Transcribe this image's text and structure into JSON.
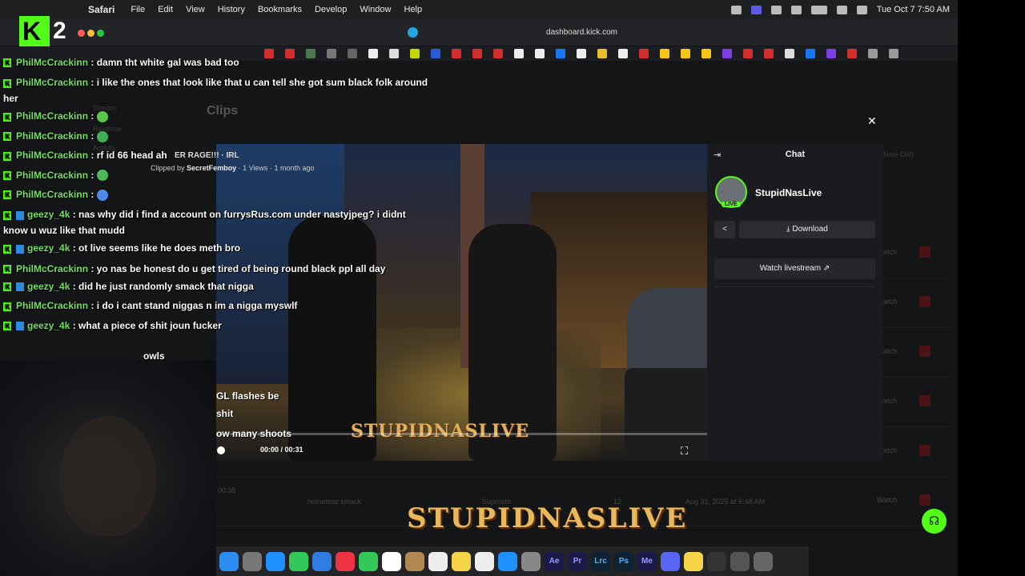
{
  "menubar": {
    "app_name": "Safari",
    "menus": [
      "File",
      "Edit",
      "View",
      "History",
      "Bookmarks",
      "Develop",
      "Window",
      "Help"
    ],
    "clock": "Tue Oct 7  7:50 AM"
  },
  "browser": {
    "url": "dashboard.kick.com"
  },
  "stream_overlay": {
    "logo_number": "2"
  },
  "dashboard": {
    "page_title": "Clips",
    "sidebar_ghost": [
      "Stream",
      "Revenue",
      "Activity"
    ],
    "sort_label": "(New-Old)",
    "row_watch_label": "Watch",
    "bottom_row": {
      "time": "00:38",
      "title": "homeless smack",
      "author": "Suprrista",
      "views": "12",
      "date": "Aug 31, 2025 at 6:48 AM",
      "action": "Watch"
    }
  },
  "clip_modal": {
    "video_title": "ER RAGE!!! · IRL",
    "clipped_by_prefix": "Clipped by",
    "clipped_by": "SecretFemboy",
    "views": "1 Views",
    "age": "1 month ago",
    "video_watermark": "STUPIDNASLIVE",
    "timecode": "00:00 / 00:31",
    "chat_header": "Chat",
    "channel_name": "StupidNasLive",
    "live_badge": "LIVE",
    "download_label": "Download",
    "watch_livestream_label": "Watch livestream"
  },
  "chat_overlay": [
    {
      "user": "PhilMcCrackinn",
      "text": ": damn tht white gal was bad too"
    },
    {
      "user": "PhilMcCrackinn",
      "text": ": i like the ones that look like that u can tell she got sum black folk around her"
    },
    {
      "user": "PhilMcCrackinn",
      "text": ":"
    },
    {
      "user": "PhilMcCrackinn",
      "text": ":"
    },
    {
      "user": "PhilMcCrackinn",
      "text": ": rf id 66 head ah"
    },
    {
      "user": "PhilMcCrackinn",
      "text": ":"
    },
    {
      "user": "PhilMcCrackinn",
      "text": ":"
    },
    {
      "user": "geezy_4k",
      "text": ": nas why did i find a account on furrysRus.com under nastyjpeg? i didnt know u wuz like that mudd"
    },
    {
      "user": "geezy_4k",
      "text": ": ot live seems like he does meth bro"
    },
    {
      "user": "PhilMcCrackinn",
      "text": ": yo nas be honest do u get tired of being round black ppl all day"
    },
    {
      "user": "geezy_4k",
      "text": ": did he just randomly smack that nigga"
    },
    {
      "user": "PhilMcCrackinn",
      "text": ": i do i cant stand niggas n im a nigga myswlf"
    },
    {
      "user": "geezy_4k",
      "text": ": what a piece of shit joun fucker"
    }
  ],
  "captions": {
    "line1": "owls",
    "line2": "GL flashes be",
    "line3": "shit",
    "line4": "ow many shoots"
  },
  "watermark": "STUPIDNASLIVE",
  "dock_labels": [
    "Ae",
    "Pr",
    "Lrc",
    "Ps",
    "Me"
  ],
  "colors": {
    "kick_green": "#53fc18",
    "chat_user_green": "#75e063",
    "watermark_gold": "#e9b85c"
  }
}
